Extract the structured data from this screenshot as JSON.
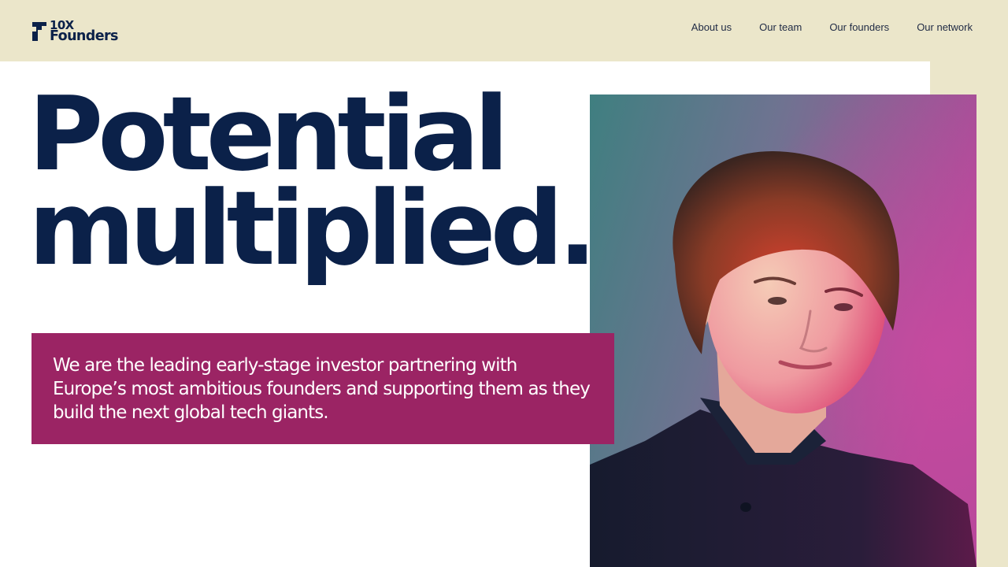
{
  "logo": {
    "line1": "10X",
    "line2": "Founders"
  },
  "nav": {
    "items": [
      {
        "label": "About us"
      },
      {
        "label": "Our team"
      },
      {
        "label": "Our founders"
      },
      {
        "label": "Our network"
      }
    ]
  },
  "hero": {
    "headline_line1": "Potential",
    "headline_line2": "multiplied.",
    "tagline": "We are the leading early-stage investor partnering with Europe’s most ambitious founders and supporting them as they build the next global tech giants."
  },
  "colors": {
    "header_bg": "#ebe6ca",
    "navy": "#0b2149",
    "tagline_bg": "#9b2464",
    "panel_bg": "#ffffff"
  },
  "icons": {
    "logo_mark": "10x-founders-logo-mark"
  }
}
